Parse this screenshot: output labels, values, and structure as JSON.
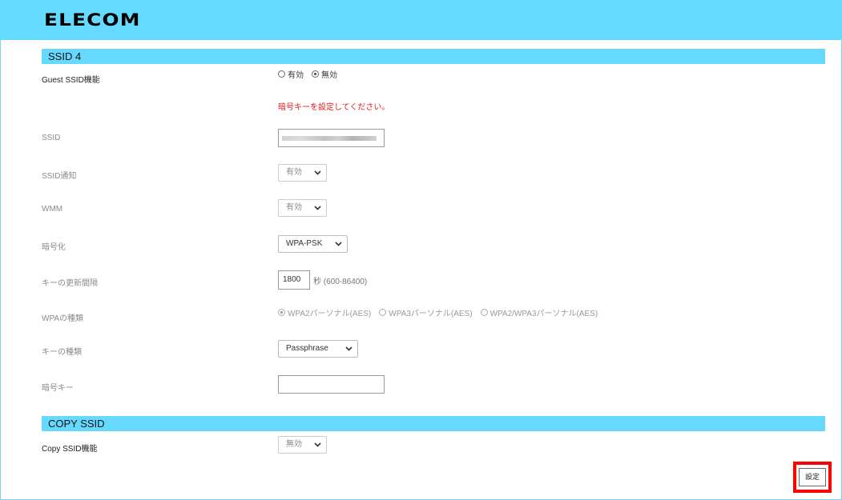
{
  "header": {
    "logo": "ELECOM",
    "bg_color": "#66d9ff"
  },
  "ssid4": {
    "title": "SSID 4",
    "guest": {
      "label": "Guest SSID機能",
      "options": [
        {
          "label": "有効",
          "selected": false
        },
        {
          "label": "無効",
          "selected": true
        }
      ]
    },
    "warning": "暗号キーを設定してください。",
    "ssid": {
      "label": "SSID",
      "value": ""
    },
    "broadcast": {
      "label": "SSID通知",
      "value": "有効"
    },
    "wmm": {
      "label": "WMM",
      "value": "有効"
    },
    "encryption": {
      "label": "暗号化",
      "value": "WPA-PSK"
    },
    "rekey": {
      "label": "キーの更新間隔",
      "value": "1800",
      "range": "秒 (600-86400)"
    },
    "wpa_type": {
      "label": "WPAの種類",
      "options": [
        {
          "label": "WPA2パーソナル(AES)",
          "selected": true
        },
        {
          "label": "WPA3パーソナル(AES)",
          "selected": false
        },
        {
          "label": "WPA2/WPA3パーソナル(AES)",
          "selected": false
        }
      ]
    },
    "key_type": {
      "label": "キーの種類",
      "value": "Passphrase"
    },
    "key": {
      "label": "暗号キー",
      "value": ""
    }
  },
  "copy": {
    "title": "COPY SSID",
    "function": {
      "label": "Copy SSID機能",
      "value": "無効"
    }
  },
  "actions": {
    "set_label": "設定",
    "highlight_color": "#ff0000"
  }
}
